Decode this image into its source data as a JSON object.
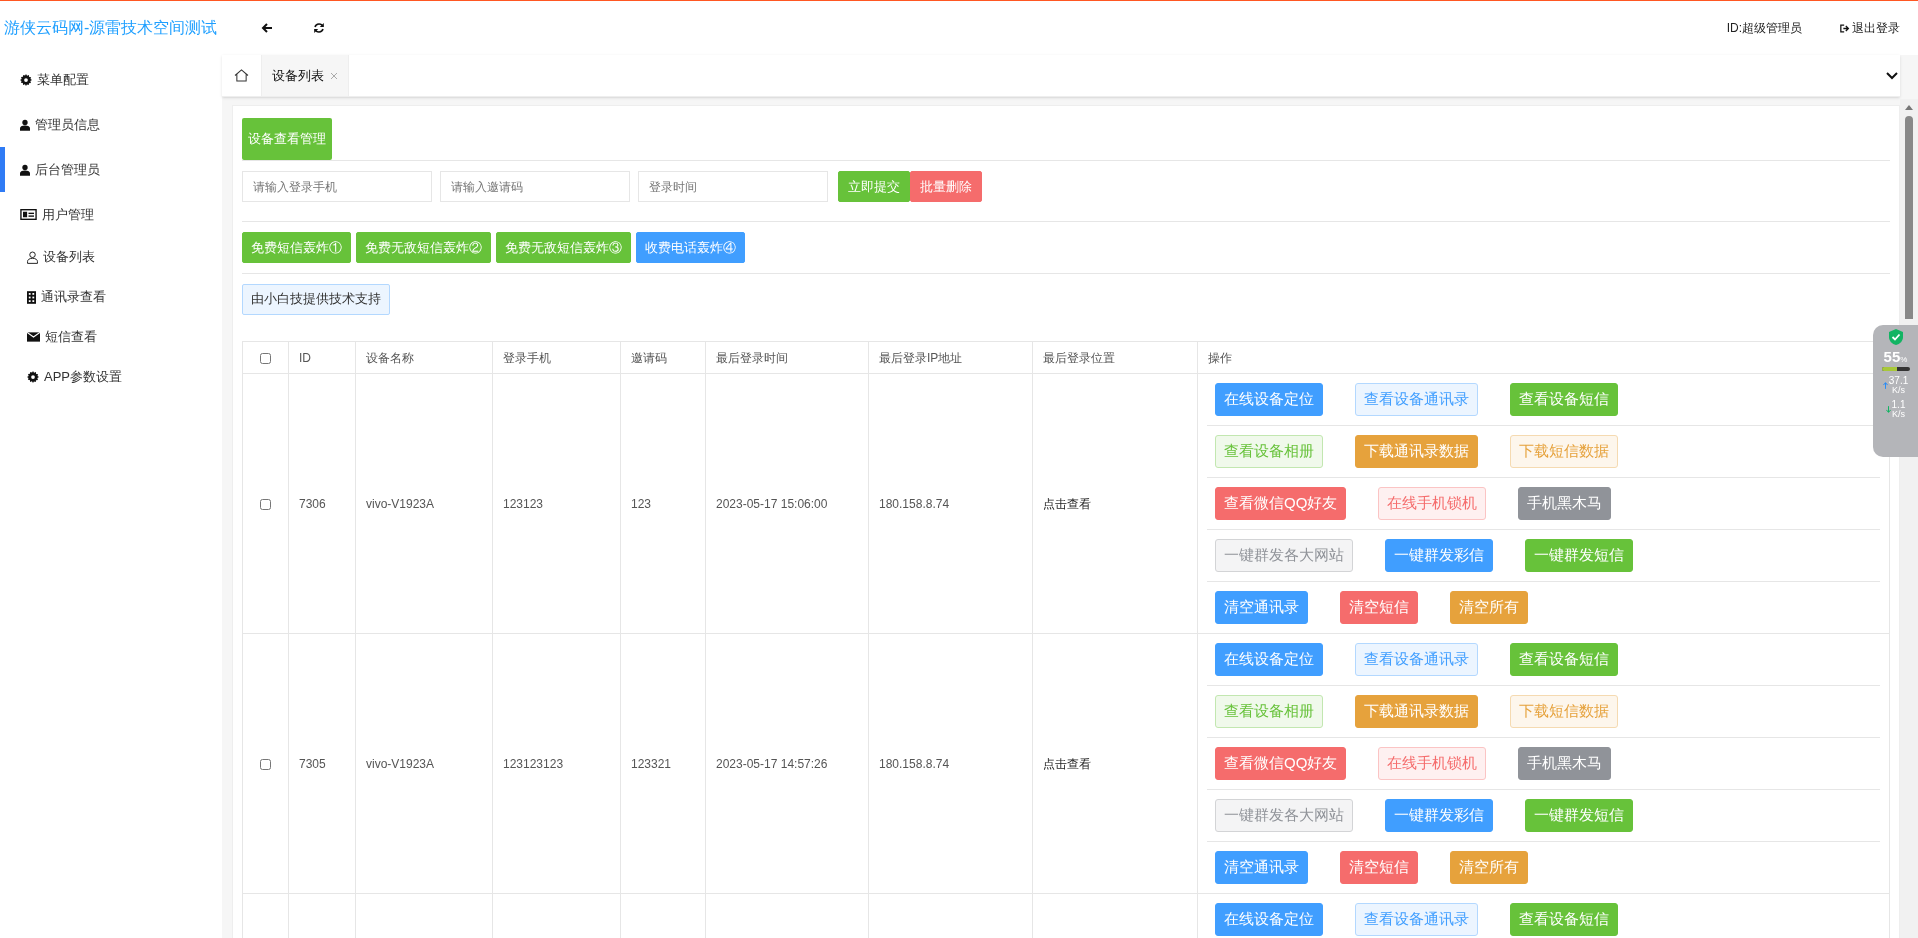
{
  "header": {
    "title": "游侠云码网-源雷技术空间测试",
    "user": "ID:超级管理员",
    "logout": "退出登录"
  },
  "sidebar": {
    "items": [
      {
        "label": "菜单配置",
        "kind": "config",
        "selected": false
      },
      {
        "label": "管理员信息",
        "kind": "admin",
        "selected": false
      },
      {
        "label": "后台管理员",
        "kind": "admin",
        "selected": true
      },
      {
        "label": "用户管理",
        "kind": "users",
        "selected": false,
        "children": [
          {
            "label": "设备列表",
            "kind": "devices",
            "selected": false
          },
          {
            "label": "通讯录查看",
            "kind": "contacts",
            "selected": false
          },
          {
            "label": "短信查看",
            "kind": "sms",
            "selected": false
          },
          {
            "label": "APP参数设置",
            "kind": "config",
            "selected": false
          }
        ]
      }
    ]
  },
  "tabs": [
    {
      "label": "设备列表",
      "selected": true
    }
  ],
  "panel": {
    "title_button": "设备查看管理",
    "filters": [
      {
        "placeholder": "请输入登录手机"
      },
      {
        "placeholder": "请输入邀请码"
      },
      {
        "placeholder": "登录时间"
      }
    ],
    "filter_buttons": [
      {
        "label": "立即提交",
        "kind": "success"
      },
      {
        "label": "批量删除",
        "kind": "danger"
      }
    ],
    "feature_buttons": [
      {
        "label": "免费短信轰炸①",
        "kind": "success"
      },
      {
        "label": "免费无敌短信轰炸②",
        "kind": "success"
      },
      {
        "label": "免费无敌短信轰炸③",
        "kind": "success"
      },
      {
        "label": "收费电话轰炸④",
        "kind": "primary"
      }
    ],
    "support_button": "由小白技提供技术支持"
  },
  "table": {
    "header_checked": false,
    "columns": [
      "ID",
      "设备名称",
      "登录手机",
      "邀请码",
      "最后登录时间",
      "最后登录IP地址",
      "最后登录位置",
      "操作"
    ],
    "rows": [
      {
        "checked": false,
        "id": "7306",
        "device": "vivo-V1923A",
        "phone": "123123",
        "invite": "123",
        "last_login": "2023-05-17 15:06:00",
        "ip": "180.158.8.74",
        "location": "点击查看",
        "actions": [
          [
            {
              "label": "在线设备定位",
              "kind": "primary"
            },
            {
              "label": "查看设备通讯录",
              "kind": "primary-plain"
            },
            {
              "label": "查看设备短信",
              "kind": "success"
            }
          ],
          [
            {
              "label": "查看设备相册",
              "kind": "success-plain"
            },
            {
              "label": "下载通讯录数据",
              "kind": "warning"
            },
            {
              "label": "下载短信数据",
              "kind": "warning-plain"
            }
          ],
          [
            {
              "label": "查看微信QQ好友",
              "kind": "danger"
            },
            {
              "label": "在线手机锁机",
              "kind": "danger-plain"
            },
            {
              "label": "手机黑木马",
              "kind": "info"
            }
          ],
          [
            {
              "label": "一键群发各大网站",
              "kind": "info-plain"
            },
            {
              "label": "一键群发彩信",
              "kind": "primary"
            },
            {
              "label": "一键群发短信",
              "kind": "success"
            }
          ],
          [
            {
              "label": "清空通讯录",
              "kind": "primary"
            },
            {
              "label": "清空短信",
              "kind": "danger"
            },
            {
              "label": "清空所有",
              "kind": "warning"
            }
          ]
        ]
      },
      {
        "checked": false,
        "id": "7305",
        "device": "vivo-V1923A",
        "phone": "123123123",
        "invite": "123321",
        "last_login": "2023-05-17 14:57:26",
        "ip": "180.158.8.74",
        "location": "点击查看",
        "actions": [
          [
            {
              "label": "在线设备定位",
              "kind": "primary"
            },
            {
              "label": "查看设备通讯录",
              "kind": "primary-plain"
            },
            {
              "label": "查看设备短信",
              "kind": "success"
            }
          ],
          [
            {
              "label": "查看设备相册",
              "kind": "success-plain"
            },
            {
              "label": "下载通讯录数据",
              "kind": "warning"
            },
            {
              "label": "下载短信数据",
              "kind": "warning-plain"
            }
          ],
          [
            {
              "label": "查看微信QQ好友",
              "kind": "danger"
            },
            {
              "label": "在线手机锁机",
              "kind": "danger-plain"
            },
            {
              "label": "手机黑木马",
              "kind": "info"
            }
          ],
          [
            {
              "label": "一键群发各大网站",
              "kind": "info-plain"
            },
            {
              "label": "一键群发彩信",
              "kind": "primary"
            },
            {
              "label": "一键群发短信",
              "kind": "success"
            }
          ],
          [
            {
              "label": "清空通讯录",
              "kind": "primary"
            },
            {
              "label": "清空短信",
              "kind": "danger"
            },
            {
              "label": "清空所有",
              "kind": "warning"
            }
          ]
        ]
      },
      {
        "actions": [
          [
            {
              "label": "在线设备定位",
              "kind": "primary"
            },
            {
              "label": "查看设备通讯录",
              "kind": "primary-plain"
            },
            {
              "label": "查看设备短信",
              "kind": "success"
            }
          ]
        ]
      }
    ]
  },
  "monitor": {
    "percent": "55",
    "unit": "%",
    "level": 0.55,
    "upload": "37.1",
    "upload_unit": "K/s",
    "download": "1.1",
    "download_unit": "K/s"
  }
}
